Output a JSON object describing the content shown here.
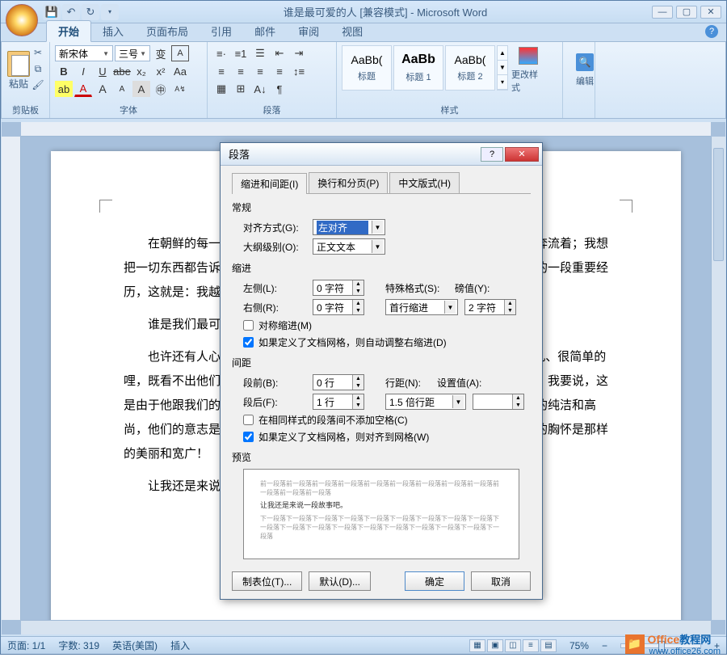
{
  "window": {
    "title": "谁是最可爱的人 [兼容模式] - Microsoft Word"
  },
  "tabs": [
    "开始",
    "插入",
    "页面布局",
    "引用",
    "邮件",
    "审阅",
    "视图"
  ],
  "ribbon": {
    "clipboard": {
      "label": "剪贴板",
      "paste": "粘贴"
    },
    "font": {
      "label": "字体",
      "name": "新宋体",
      "size": "三号"
    },
    "paragraph": {
      "label": "段落"
    },
    "styles": {
      "label": "样式",
      "items": [
        {
          "preview": "AaBb(",
          "name": "标题"
        },
        {
          "preview": "AaBb",
          "name": "标题 1"
        },
        {
          "preview": "AaBb(",
          "name": "标题 2"
        }
      ],
      "change": "更改样式"
    },
    "edit": {
      "label": "编辑"
    }
  },
  "document": {
    "p1": "在朝鲜的每一天，我都被一些东西感动着；我的思想感情的潮水，在放纵奔流着；我想把一切东西都告诉给我祖国的朋友们。但我最急于告诉你们的，是我思想感情的一段重要经历，这就是：我越来越深刻地感觉到谁是我们最可爱的人！",
    "p2": "谁是我们最可爱的人呢？我们的战士，我感到他们是最可爱的人。",
    "p3": "也许还有人心里隐隐约约地说：你说的就是那些\"兵\"吗？他们看来是很平凡、很简单的哩，既看不出他们有什么高深的知识，又看不出他们有什么丰富的感情。可是，我要说，这是由于他跟我们的战士接触太少，还没有了解我们的战士：他们的品质是那样的纯洁和高尚，他们的意志是那样的坚韧和刚强，他们的气质是那样的淳朴和谦逊，他们的胸怀是那样的美丽和宽广！",
    "p4": "让我还是来说一段故事吧。"
  },
  "dialog": {
    "title": "段落",
    "tabs": [
      "缩进和间距(I)",
      "换行和分页(P)",
      "中文版式(H)"
    ],
    "general": {
      "title": "常规",
      "align_label": "对齐方式(G):",
      "align_value": "左对齐",
      "outline_label": "大纲级别(O):",
      "outline_value": "正文文本"
    },
    "indent": {
      "title": "缩进",
      "left_label": "左侧(L):",
      "left_value": "0 字符",
      "right_label": "右侧(R):",
      "right_value": "0 字符",
      "special_label": "特殊格式(S):",
      "special_value": "首行缩进",
      "by_label": "磅值(Y):",
      "by_value": "2 字符",
      "mirror": "对称缩进(M)",
      "grid": "如果定义了文档网格，则自动调整右缩进(D)"
    },
    "spacing": {
      "title": "间距",
      "before_label": "段前(B):",
      "before_value": "0 行",
      "after_label": "段后(F):",
      "after_value": "1 行",
      "line_label": "行距(N):",
      "line_value": "1.5 倍行距",
      "at_label": "设置值(A):",
      "at_value": "",
      "nospace": "在相同样式的段落间不添加空格(C)",
      "snap": "如果定义了文档网格，则对齐到网格(W)"
    },
    "preview": {
      "title": "预览",
      "sample": "让我还是来说一段故事吧。"
    },
    "buttons": {
      "tabs": "制表位(T)...",
      "default": "默认(D)...",
      "ok": "确定",
      "cancel": "取消"
    }
  },
  "status": {
    "page": "页面: 1/1",
    "words": "字数: 319",
    "lang": "英语(美国)",
    "mode": "插入",
    "zoom": "75%"
  },
  "watermark": {
    "brand1": "Office",
    "brand2": "教程网",
    "url": "www.office26.com"
  }
}
